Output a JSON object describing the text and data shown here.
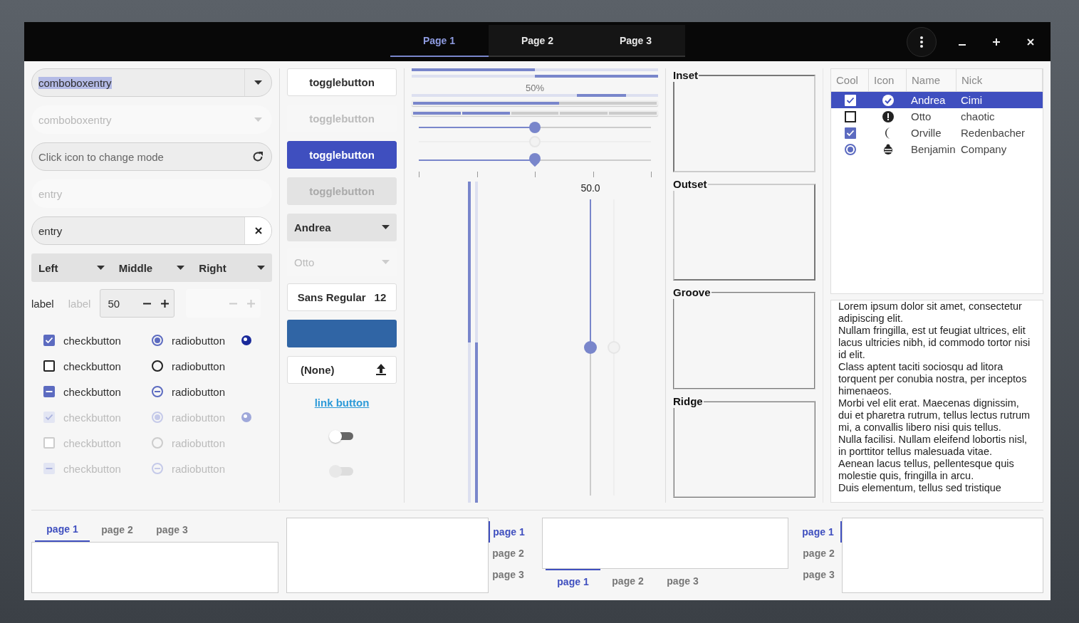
{
  "header": {
    "tabs": [
      {
        "label": "Page 1",
        "selected": true
      },
      {
        "label": "Page 2",
        "selected": false
      },
      {
        "label": "Page 3",
        "selected": false
      }
    ]
  },
  "entries": [
    {
      "kind": "combo",
      "value": "comboboxentry",
      "text_selected": true,
      "disabled": false
    },
    {
      "kind": "combo",
      "value": "comboboxentry",
      "text_selected": false,
      "disabled": true
    },
    {
      "kind": "icon",
      "placeholder": "Click icon to change mode",
      "disabled": false
    },
    {
      "kind": "plain",
      "value": "entry",
      "disabled": true
    },
    {
      "kind": "clear",
      "value": "entry",
      "disabled": false
    }
  ],
  "dropdowns": [
    {
      "label": "Left"
    },
    {
      "label": "Middle"
    },
    {
      "label": "Right"
    }
  ],
  "spin_row": {
    "labels": [
      {
        "text": "label",
        "disabled": false
      },
      {
        "text": "label",
        "disabled": true
      }
    ],
    "spins": [
      {
        "value": "50",
        "disabled": false
      },
      {
        "disabled": true
      }
    ]
  },
  "checks": [
    {
      "check_checked": true,
      "check_mixed": false,
      "check_label": "checkbutton",
      "radio_checked": true,
      "radio_mixed": false,
      "radio_label": "radiobutton",
      "disabled": false,
      "extra_radio": true
    },
    {
      "check_checked": false,
      "check_mixed": false,
      "check_label": "checkbutton",
      "radio_checked": false,
      "radio_mixed": false,
      "radio_label": "radiobutton",
      "disabled": false,
      "extra_radio": false
    },
    {
      "check_mixed": true,
      "check_label": "checkbutton",
      "radio_mixed": true,
      "radio_label": "radiobutton",
      "disabled": false,
      "extra_radio": false
    },
    {
      "check_checked": true,
      "check_mixed": false,
      "check_label": "checkbutton",
      "radio_checked": true,
      "radio_mixed": false,
      "radio_label": "radiobutton",
      "disabled": true,
      "extra_radio": true
    },
    {
      "check_checked": false,
      "check_mixed": false,
      "check_label": "checkbutton",
      "radio_checked": false,
      "radio_mixed": false,
      "radio_label": "radiobutton",
      "disabled": true,
      "extra_radio": false
    },
    {
      "check_mixed": true,
      "check_label": "checkbutton",
      "radio_mixed": true,
      "radio_label": "radiobutton",
      "disabled": true,
      "extra_radio": false
    }
  ],
  "toggles": [
    {
      "label": "togglebutton",
      "active": false,
      "disabled": false
    },
    {
      "label": "togglebutton",
      "active": false,
      "disabled": true
    },
    {
      "label": "togglebutton",
      "active": true,
      "disabled": false
    },
    {
      "label": "togglebutton",
      "active": true,
      "disabled": true
    }
  ],
  "combos": [
    {
      "value": "Andrea",
      "disabled": false
    },
    {
      "value": "Otto",
      "disabled": true
    }
  ],
  "font_button": {
    "family": "Sans Regular",
    "size": "12"
  },
  "color_button": {
    "color": "#3065a5"
  },
  "file_button": {
    "label": "(None)"
  },
  "link_button": {
    "label": "link button"
  },
  "switches": [
    {
      "on": false,
      "disabled": false
    },
    {
      "on": false,
      "disabled": true
    }
  ],
  "progress": [
    {
      "kind": "normal",
      "level": 0.5
    },
    {
      "kind": "inverted",
      "level": 0.5
    },
    {
      "kind": "pulse",
      "text": "50%"
    }
  ],
  "level_bars": [
    {
      "kind": "continuous",
      "level": 0.6
    },
    {
      "kind": "discrete",
      "level": 0.4
    }
  ],
  "scales": [
    {
      "level": 0.5,
      "disabled": false,
      "marks": false
    },
    {
      "level": 0.5,
      "disabled": true,
      "marks": false
    },
    {
      "level": 0.5,
      "disabled": false,
      "marks": true
    }
  ],
  "vprogress": [
    {
      "level": 0.5,
      "inverted": false
    },
    {
      "level": 0.5,
      "inverted": true
    }
  ],
  "vscales": [
    {
      "level": 0.5,
      "value": "50.0",
      "disabled": false
    },
    {
      "level": 0.5,
      "disabled": true
    }
  ],
  "frames": [
    {
      "label": "Inset",
      "kind": "inset"
    },
    {
      "label": "Outset",
      "kind": "outset"
    },
    {
      "label": "Groove",
      "kind": "groove"
    },
    {
      "label": "Ridge",
      "kind": "ridge"
    }
  ],
  "tree": {
    "columns": [
      "Cool",
      "Icon",
      "Name",
      "Nick"
    ],
    "rows": [
      {
        "kind": "check",
        "cool_checked": true,
        "name": "Andrea",
        "nick": "Cimi",
        "selected": true
      },
      {
        "kind": "check",
        "cool_checked": false,
        "name": "Otto",
        "nick": "chaotic",
        "selected": false
      },
      {
        "kind": "check",
        "cool_checked": true,
        "name": "Orville",
        "nick": "Redenbacher",
        "selected": false
      },
      {
        "kind": "radio",
        "cool_checked": true,
        "name": "Benjamin",
        "nick": "Company",
        "selected": false
      }
    ]
  },
  "text_view": {
    "paragraphs": [
      "Lorem ipsum dolor sit amet, consectetur adipiscing elit.",
      "Nullam fringilla, est ut feugiat ultrices, elit lacus ultricies nibh, id commodo tortor nisi id elit.",
      "Class aptent taciti sociosqu ad litora torquent per conubia nostra, per inceptos himenaeos.",
      "Morbi vel elit erat. Maecenas dignissim, dui et pharetra rutrum, tellus lectus rutrum mi, a convallis libero nisi quis tellus.",
      "Nulla facilisi. Nullam eleifend lobortis nisl, in porttitor tellus malesuada vitae.",
      "Aenean lacus tellus, pellentesque quis molestie quis, fringilla in arcu.",
      "Duis elementum, tellus sed tristique"
    ]
  },
  "notebooks": [
    {
      "kind": "top",
      "tabs": [
        {
          "label": "page 1",
          "selected": true
        },
        {
          "label": "page 2",
          "selected": false
        },
        {
          "label": "page 3",
          "selected": false
        }
      ]
    },
    {
      "kind": "right",
      "tabs": [
        {
          "label": "page 1",
          "selected": true
        },
        {
          "label": "page 2",
          "selected": false
        },
        {
          "label": "page 3",
          "selected": false
        }
      ]
    },
    {
      "kind": "bottom",
      "tabs": [
        {
          "label": "page 1",
          "selected": true
        },
        {
          "label": "page 2",
          "selected": false
        },
        {
          "label": "page 3",
          "selected": false
        }
      ]
    },
    {
      "kind": "left",
      "tabs": [
        {
          "label": "page 1",
          "selected": true
        },
        {
          "label": "page 2",
          "selected": false
        },
        {
          "label": "page 3",
          "selected": false
        }
      ]
    }
  ]
}
